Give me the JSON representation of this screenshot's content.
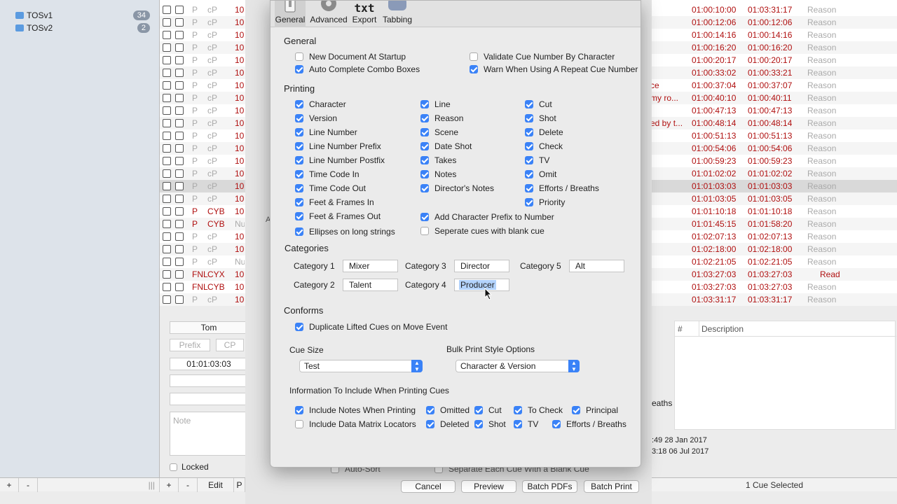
{
  "sidebar": {
    "items": [
      {
        "label": "TOSv1",
        "count": "34"
      },
      {
        "label": "TOSv2",
        "count": "2"
      }
    ]
  },
  "bottombar": {
    "add": "+",
    "remove": "-",
    "resize": "|||",
    "add2": "+",
    "remove2": "-",
    "edit": "Edit",
    "p": "P",
    "status": "1 Cue Selected"
  },
  "table": {
    "rows": [
      {
        "p": "P",
        "cp": "cP",
        "num": "10",
        "in": "01:00:10:00",
        "out": "01:03:31:17",
        "reason": "Reason",
        "note": ""
      },
      {
        "p": "P",
        "cp": "cP",
        "num": "10",
        "in": "01:00:12:06",
        "out": "01:00:12:06",
        "reason": "Reason",
        "note": ""
      },
      {
        "p": "P",
        "cp": "cP",
        "num": "10",
        "in": "01:00:14:16",
        "out": "01:00:14:16",
        "reason": "Reason",
        "note": ""
      },
      {
        "p": "P",
        "cp": "cP",
        "num": "10",
        "in": "01:00:16:20",
        "out": "01:00:16:20",
        "reason": "Reason",
        "note": ""
      },
      {
        "p": "P",
        "cp": "cP",
        "num": "10",
        "in": "01:00:20:17",
        "out": "01:00:20:17",
        "reason": "Reason",
        "note": ""
      },
      {
        "p": "P",
        "cp": "cP",
        "num": "10",
        "in": "01:00:33:02",
        "out": "01:00:33:21",
        "reason": "Reason",
        "note": ""
      },
      {
        "p": "P",
        "cp": "cP",
        "num": "10",
        "in": "01:00:37:04",
        "out": "01:00:37:07",
        "reason": "Reason",
        "note": "ce"
      },
      {
        "p": "P",
        "cp": "cP",
        "num": "10",
        "in": "01:00:40:10",
        "out": "01:00:40:11",
        "reason": "Reason",
        "note": "my ro..."
      },
      {
        "p": "P",
        "cp": "cP",
        "num": "10",
        "in": "01:00:47:13",
        "out": "01:00:47:13",
        "reason": "Reason",
        "note": ""
      },
      {
        "p": "P",
        "cp": "cP",
        "num": "10",
        "in": "01:00:48:14",
        "out": "01:00:48:14",
        "reason": "Reason",
        "note": "ed by t..."
      },
      {
        "p": "P",
        "cp": "cP",
        "num": "10",
        "in": "01:00:51:13",
        "out": "01:00:51:13",
        "reason": "Reason",
        "note": ""
      },
      {
        "p": "P",
        "cp": "cP",
        "num": "10",
        "in": "01:00:54:06",
        "out": "01:00:54:06",
        "reason": "Reason",
        "note": ""
      },
      {
        "p": "P",
        "cp": "cP",
        "num": "10",
        "in": "01:00:59:23",
        "out": "01:00:59:23",
        "reason": "Reason",
        "note": ""
      },
      {
        "p": "P",
        "cp": "cP",
        "num": "10",
        "in": "01:01:02:02",
        "out": "01:01:02:02",
        "reason": "Reason",
        "note": ""
      },
      {
        "p": "P",
        "cp": "cP",
        "num": "10",
        "in": "01:01:03:03",
        "out": "01:01:03:03",
        "reason": "Reason",
        "note": ""
      },
      {
        "p": "P",
        "cp": "cP",
        "num": "10",
        "in": "01:01:03:05",
        "out": "01:01:03:05",
        "reason": "Reason",
        "note": ""
      },
      {
        "p": "P",
        "cp": "CYB",
        "num": "10",
        "in": "01:01:10:18",
        "out": "01:01:10:18",
        "reason": "Reason",
        "note": ""
      },
      {
        "p": "P",
        "cp": "CYB",
        "num": "Nu",
        "in": "01:01:45:15",
        "out": "01:01:58:20",
        "reason": "Reason",
        "note": ""
      },
      {
        "p": "P",
        "cp": "cP",
        "num": "10",
        "in": "01:02:07:13",
        "out": "01:02:07:13",
        "reason": "Reason",
        "note": ""
      },
      {
        "p": "P",
        "cp": "cP",
        "num": "10",
        "in": "01:02:18:00",
        "out": "01:02:18:00",
        "reason": "Reason",
        "note": ""
      },
      {
        "p": "P",
        "cp": "cP",
        "num": "Nu",
        "in": "01:02:21:05",
        "out": "01:02:21:05",
        "reason": "Reason",
        "note": ""
      },
      {
        "p": "FNL",
        "cp": "CYX",
        "num": "10",
        "in": "01:03:27:03",
        "out": "01:03:27:03",
        "reason": "Read",
        "note": ""
      },
      {
        "p": "FNL",
        "cp": "CYB",
        "num": "10",
        "in": "01:03:27:03",
        "out": "01:03:27:03",
        "reason": "Reason",
        "note": ""
      },
      {
        "p": "P",
        "cp": "cP",
        "num": "10",
        "in": "01:03:31:17",
        "out": "01:03:31:17",
        "reason": "Reason",
        "note": ""
      }
    ]
  },
  "detail": {
    "name": "Tom",
    "prefix": "Prefix",
    "cp": "CP",
    "timecode": "01:01:03:03",
    "note_placeholder": "Note",
    "locked": "Locked"
  },
  "rightpanel": {
    "col_hash": "#",
    "col_desc": "Description",
    "eaths": "eaths",
    "date1": ":49 28 Jan 2017",
    "date2": "3:18 06 Jul 2017"
  },
  "dialog": {
    "tabs": [
      {
        "label": "General",
        "icon": "switch-icon"
      },
      {
        "label": "Advanced",
        "icon": "gear-icon"
      },
      {
        "label": "Export",
        "icon": "txt-icon"
      },
      {
        "label": "Tabbing",
        "icon": "tabbing-icon"
      }
    ],
    "txt_glyph": "txt",
    "general": {
      "title": "General",
      "new_doc": "New Document At Startup",
      "auto_complete": "Auto Complete Combo Boxes",
      "validate": "Validate Cue Number By Character",
      "warn_repeat": "Warn When Using A Repeat Cue Number"
    },
    "printing": {
      "title": "Printing",
      "col1": [
        "Character",
        "Version",
        "Line Number",
        "Line Number Prefix",
        "Line Number Postfix",
        "Time Code In",
        "Time Code Out",
        "Feet & Frames In",
        "Feet & Frames Out",
        "Ellipses on long strings"
      ],
      "col2": [
        "Line",
        "Reason",
        "Scene",
        "Date Shot",
        "Takes",
        "Notes",
        "Director's Notes"
      ],
      "col3": [
        "Cut",
        "Shot",
        "Delete",
        "Check",
        "TV",
        "Omit",
        "Efforts / Breaths",
        "Priority"
      ],
      "add_prefix": "Add Character Prefix to Number",
      "separate": "Seperate cues with blank cue"
    },
    "categories": {
      "title": "Categories",
      "items": [
        {
          "label": "Category 1",
          "value": "Mixer"
        },
        {
          "label": "Category 2",
          "value": "Talent"
        },
        {
          "label": "Category 3",
          "value": "Director"
        },
        {
          "label": "Category 4",
          "value": "Producer"
        },
        {
          "label": "Category 5",
          "value": "Alt"
        }
      ]
    },
    "conforms": {
      "title": "Conforms",
      "duplicate": "Duplicate Lifted Cues on Move Event"
    },
    "cue_size": {
      "label": "Cue Size",
      "value": "Test"
    },
    "bulk_print": {
      "label": "Bulk Print Style Options",
      "value": "Character & Version"
    },
    "info": {
      "title": "Information To Include When Printing Cues",
      "include_notes": "Include Notes When Printing",
      "include_matrix": "Include Data Matrix Locators",
      "omitted": "Omitted",
      "deleted": "Deleted",
      "cut": "Cut",
      "shot": "Shot",
      "to_check": "To Check",
      "tv": "TV",
      "principal": "Principal",
      "efforts": "Efforts / Breaths"
    }
  },
  "sheet": {
    "auto_sort": "Auto-Sort",
    "separate_each": "Separate Each Cue With a Blank Cue",
    "buttons": {
      "cancel": "Cancel",
      "preview": "Preview",
      "batch_pdfs": "Batch PDFs",
      "batch_print": "Batch Print"
    },
    "side_a": "A"
  },
  "colors": {
    "accent": "#3a82f7",
    "red": "#b01010"
  }
}
